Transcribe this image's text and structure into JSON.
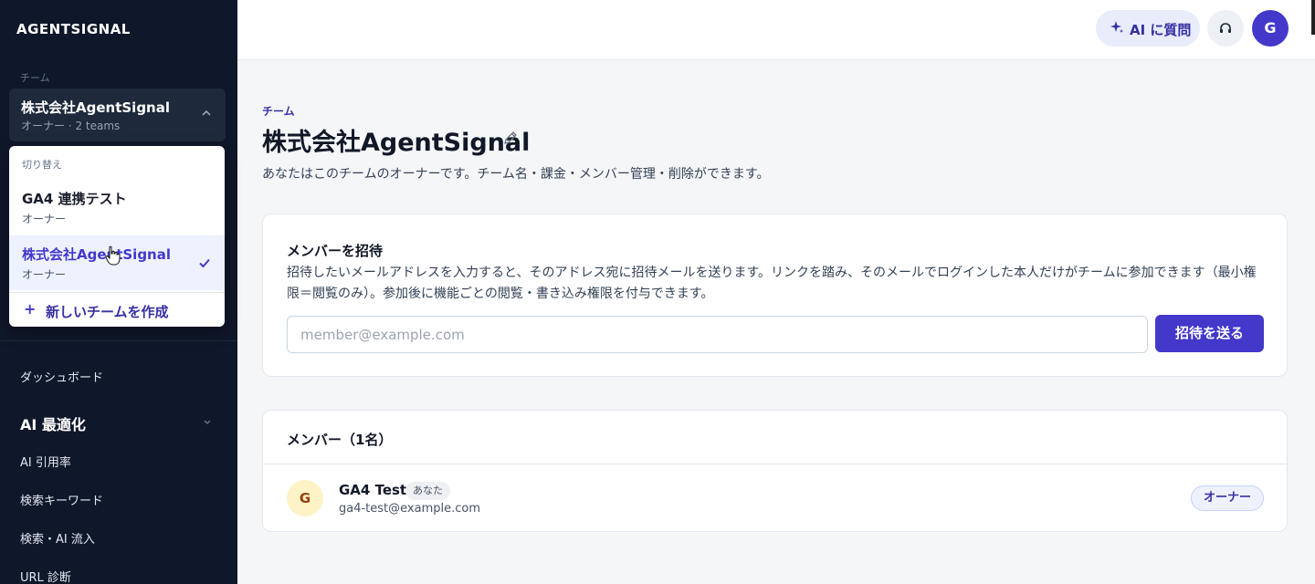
{
  "brand": "AGENTSIGNAL",
  "sidebar": {
    "team_caption": "チーム",
    "current_team": {
      "name": "株式会社AgentSignal",
      "sub": "オーナー · 2 teams"
    },
    "dropdown": {
      "caption": "切り替え",
      "items": [
        {
          "name": "GA4 連携テスト",
          "role": "オーナー",
          "selected": false
        },
        {
          "name": "株式会社AgentSignal",
          "role": "オーナー",
          "selected": true
        }
      ],
      "new_team_label": "新しいチームを作成"
    },
    "nav": {
      "dashboard": "ダッシュボード",
      "ai_group": "AI 最適化",
      "ai_citation": "AI 引用率",
      "search_keywords": "検索キーワード",
      "search_ai_traffic": "検索・AI 流入",
      "url_diagnosis": "URL 診断"
    }
  },
  "topbar": {
    "ai_button": "AI に質問",
    "avatar_initial": "G"
  },
  "main": {
    "kicker": "チーム",
    "title": "株式会社AgentSignal",
    "description": "あなたはこのチームのオーナーです。チーム名・課金・メンバー管理・削除ができます。",
    "invite": {
      "title": "メンバーを招待",
      "description": "招待したいメールアドレスを入力すると、そのアドレス宛に招待メールを送ります。リンクを踏み、そのメールでログインした本人だけがチームに参加できます（最小権限＝閲覧のみ）。参加後に機能ごとの閲覧・書き込み権限を付与できます。",
      "input_value": "",
      "input_placeholder": "member@example.com",
      "send_label": "招待を送る"
    },
    "members": {
      "title": "メンバー（1名）",
      "list": [
        {
          "initial": "G",
          "name": "GA4 Test",
          "you_badge": "あなた",
          "email": "ga4-test@example.com",
          "role": "オーナー"
        }
      ]
    }
  },
  "colors": {
    "sidebar_bg": "#0f172a",
    "accent": "#4338ca",
    "page_bg": "#f5f6f8"
  }
}
